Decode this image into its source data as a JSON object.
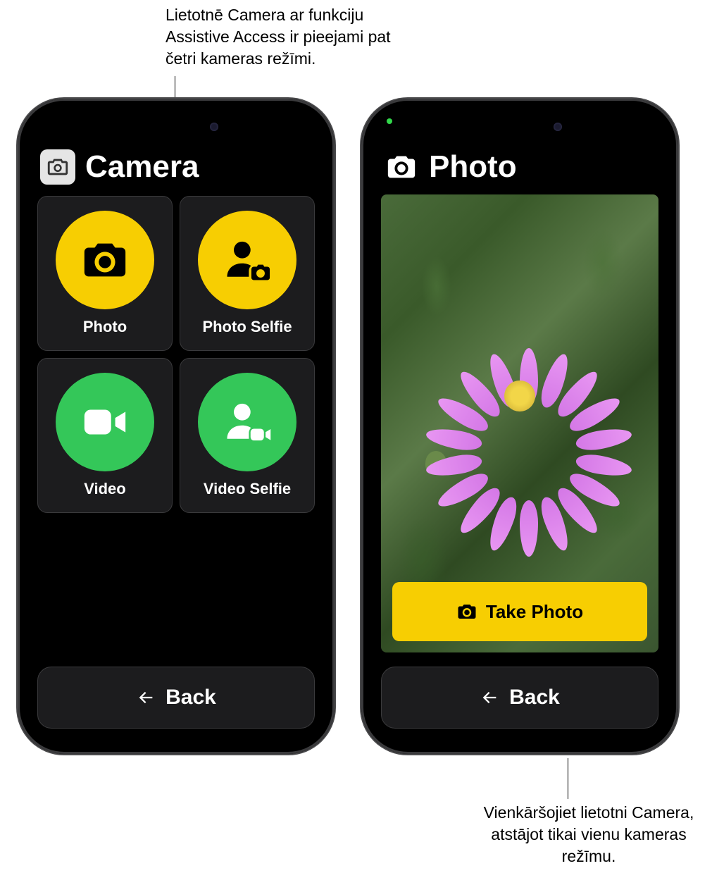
{
  "callouts": {
    "top": "Lietotnē Camera ar funkciju Assistive Access ir pieejami pat četri kameras režīmi.",
    "bottom": "Vienkāršojiet lietotni Camera, atstājot tikai vienu kameras režīmu."
  },
  "phone_left": {
    "title": "Camera",
    "tiles": [
      {
        "label": "Photo"
      },
      {
        "label": "Photo Selfie"
      },
      {
        "label": "Video"
      },
      {
        "label": "Video Selfie"
      }
    ],
    "back_label": "Back"
  },
  "phone_right": {
    "title": "Photo",
    "take_photo_label": "Take Photo",
    "back_label": "Back"
  },
  "colors": {
    "yellow": "#f7ce02",
    "green": "#34c759"
  }
}
